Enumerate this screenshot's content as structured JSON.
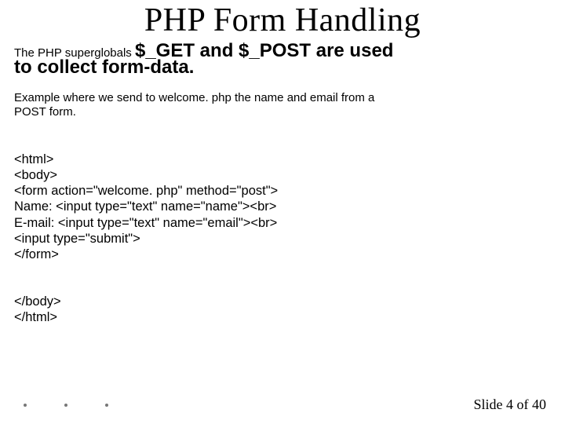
{
  "title": "PHP Form Handling",
  "intro": {
    "lead": "The PHP superglobals ",
    "strong": "$_GET and $_POST are used",
    "line2": "to collect form-data."
  },
  "example": {
    "line1": "Example where we send to welcome. php the name and email from a",
    "line2": "POST form."
  },
  "code": {
    "l1": "<html>",
    "l2": "<body>",
    "l3": "<form action=\"welcome. php\" method=\"post\">",
    "l4": "Name: <input type=\"text\" name=\"name\"><br>",
    "l5": "E-mail: <input type=\"text\" name=\"email\"><br>",
    "l6": "<input type=\"submit\">",
    "l7": "</form>",
    "l8": "</body>",
    "l9": "</html>"
  },
  "footer": {
    "page": "Slide 4 of 40"
  }
}
